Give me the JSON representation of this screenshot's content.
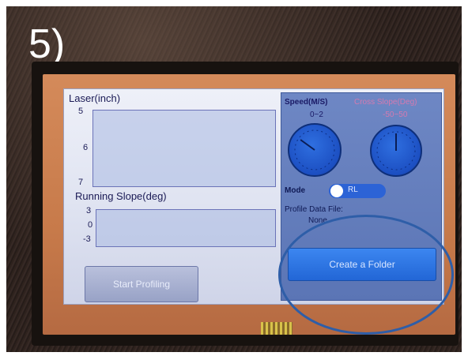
{
  "step_label": "5)",
  "laser": {
    "label": "Laser(inch)",
    "ticks": [
      "5",
      "6",
      "7"
    ]
  },
  "slope": {
    "label": "Running Slope(deg)",
    "ticks": [
      "3",
      "0",
      "-3"
    ]
  },
  "start_button_label": "Start Profiling",
  "speed": {
    "label": "Speed(M/S)",
    "range": "0~2",
    "needle_value": 0.6
  },
  "cross_slope": {
    "label": "Cross Slope(Deg)",
    "range": "-50~50",
    "needle_value": 0
  },
  "mode": {
    "label": "Mode",
    "toggle_text": "RL"
  },
  "profile_file": {
    "label": "Profile Data File:",
    "value": "None"
  },
  "create_folder_label": "Create a Folder",
  "colors": {
    "annotation": "#2e5ea8",
    "screen": "#dfe3f1",
    "panel": "#5b75b5",
    "button": "#2266d6"
  }
}
